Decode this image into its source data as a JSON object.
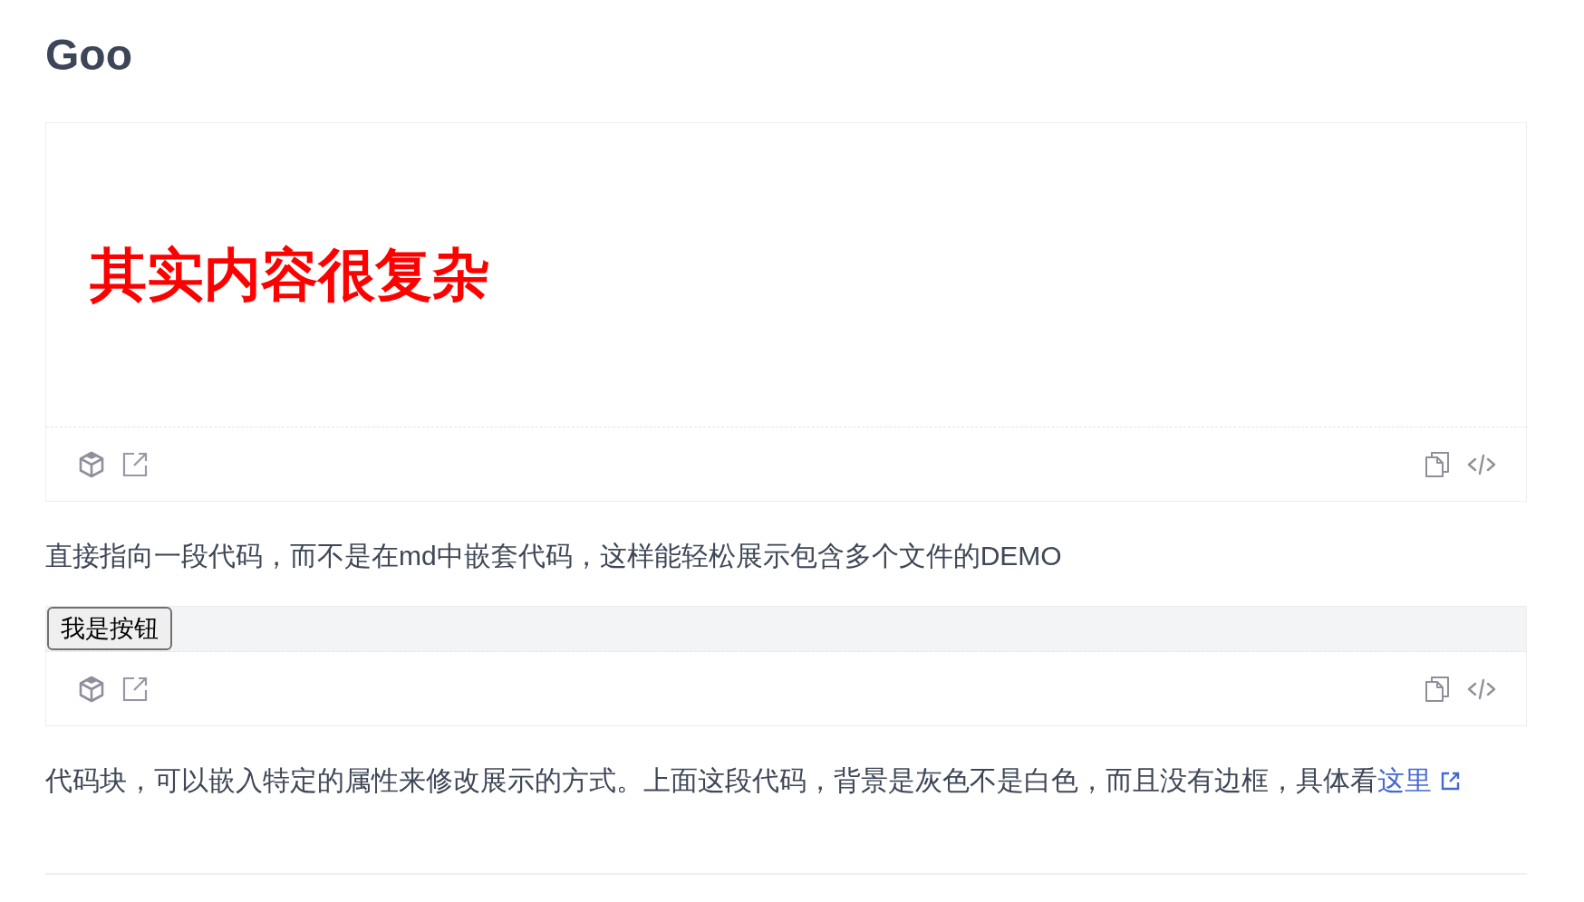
{
  "title": "Goo",
  "blocks": [
    {
      "kind": "demo",
      "preview": {
        "kind": "heading",
        "text": "其实内容很复杂",
        "shaded": false
      }
    },
    {
      "kind": "paragraph",
      "text": "直接指向一段代码，而不是在md中嵌套代码，这样能轻松展示包含多个文件的DEMO"
    },
    {
      "kind": "demo",
      "preview": {
        "kind": "button",
        "label": "我是按钮",
        "shaded": true
      }
    },
    {
      "kind": "paragraph",
      "text": "代码块，可以嵌入特定的属性来修改展示的方式。上面这段代码，背景是灰色不是白色，而且没有边框，具体看",
      "link": {
        "text": "这里"
      }
    }
  ]
}
